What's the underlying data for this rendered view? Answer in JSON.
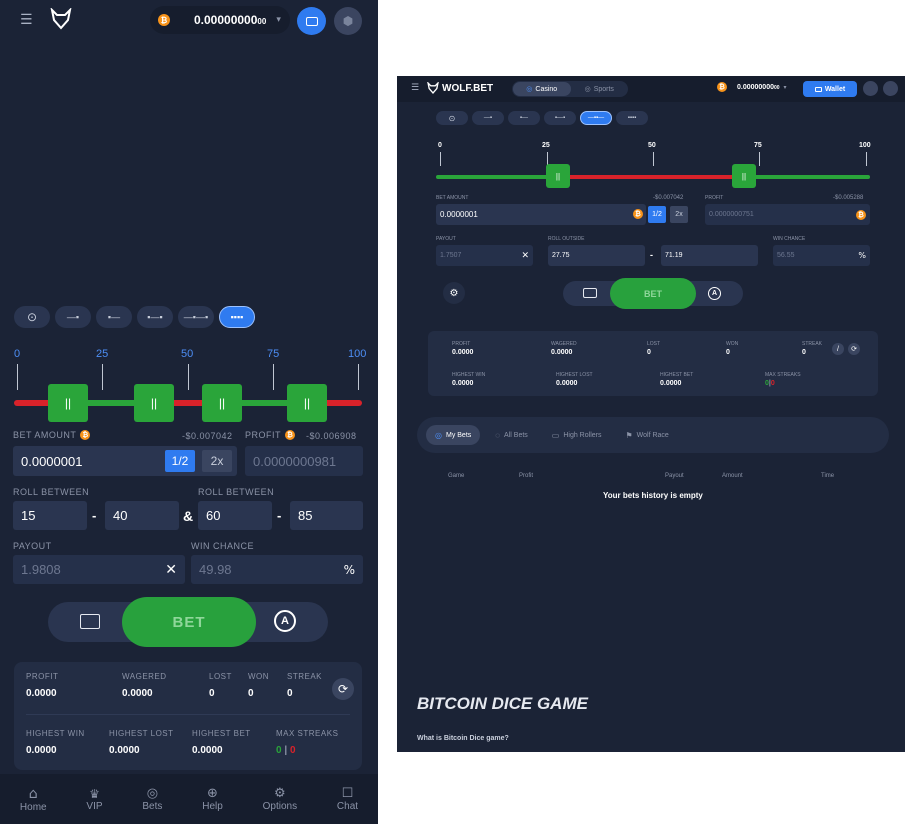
{
  "mobile": {
    "balance": "0.00000000",
    "balance_suffix": "00",
    "bet_types": [
      "⊙",
      "—▪",
      "▪—",
      "▪—▪",
      "—▪—▪",
      "▪▪▪▪"
    ],
    "slider_ticks": [
      "0",
      "25",
      "50",
      "75",
      "100"
    ],
    "bet_amount_label": "BET AMOUNT",
    "bet_amount_usd": "-$0.007042",
    "profit_label": "PROFIT",
    "profit_usd": "-$0.006908",
    "bet_amount_value": "0.0000001",
    "half": "1/2",
    "double": "2x",
    "profit_value": "0.0000000981",
    "roll_between_1": "ROLL BETWEEN",
    "roll_between_2": "ROLL BETWEEN",
    "range1_low": "15",
    "range1_high": "40",
    "range2_low": "60",
    "range2_high": "85",
    "dash": "-",
    "amp": "&",
    "payout_label": "PAYOUT",
    "payout_value": "1.9808",
    "win_chance_label": "WIN CHANCE",
    "win_chance_value": "49.98",
    "bet_button": "BET",
    "stats": {
      "profit_label": "PROFIT",
      "profit": "0.0000",
      "wagered_label": "WAGERED",
      "wagered": "0.0000",
      "lost_label": "LOST",
      "lost": "0",
      "won_label": "WON",
      "won": "0",
      "streak_label": "STREAK",
      "streak": "0",
      "highest_win_label": "HIGHEST WIN",
      "highest_win": "0.0000",
      "highest_lost_label": "HIGHEST LOST",
      "highest_lost": "0.0000",
      "highest_bet_label": "HIGHEST BET",
      "highest_bet": "0.0000",
      "max_streaks_label": "MAX STREAKS",
      "max_win_streak": "0",
      "max_sep": "|",
      "max_lose_streak": "0"
    },
    "nav": [
      "Home",
      "VIP",
      "Bets",
      "Help",
      "Options",
      "Chat"
    ]
  },
  "desktop": {
    "logo": "WOLF.BET",
    "tab_casino": "Casino",
    "tab_sports": "Sports",
    "balance": "0.00000000",
    "balance_suffix": "00",
    "wallet": "Wallet",
    "slider_ticks": [
      "0",
      "25",
      "50",
      "75",
      "100"
    ],
    "bet_amount_label": "BET AMOUNT",
    "bet_amount_usd": "-$0.007042",
    "bet_amount_value": "0.0000001",
    "half": "1/2",
    "double": "2x",
    "profit_label": "PROFIT",
    "profit_usd": "-$0.005288",
    "profit_value": "0.0000000751",
    "payout_label": "PAYOUT",
    "payout_value": "1.7507",
    "roll_outside_label": "ROLL OUTSIDE",
    "roll_low": "27.75",
    "roll_dash": "-",
    "roll_high": "71.19",
    "win_chance_label": "WIN CHANCE",
    "win_chance_value": "56.55",
    "bet_button": "BET",
    "stats": {
      "profit_label": "PROFIT",
      "profit": "0.0000",
      "wagered_label": "WAGERED",
      "wagered": "0.0000",
      "lost_label": "LOST",
      "lost": "0",
      "won_label": "WON",
      "won": "0",
      "streak_label": "STREAK",
      "streak": "0",
      "highest_win_label": "HIGHEST WIN",
      "highest_win": "0.0000",
      "highest_lost_label": "HIGHEST LOST",
      "highest_lost": "0.0000",
      "highest_bet_label": "HIGHEST BET",
      "highest_bet": "0.0000",
      "max_streaks_label": "MAX STREAKS",
      "max_win_streak": "0",
      "max_sep": "|",
      "max_lose_streak": "0"
    },
    "bet_tabs": [
      "My Bets",
      "All Bets",
      "High Rollers",
      "Wolf Race"
    ],
    "table_headers": [
      "Game",
      "Profit",
      "Payout",
      "Amount",
      "Time"
    ],
    "empty_text": "Your bets history is empty",
    "seo_title": "BITCOIN DICE GAME",
    "seo_sub": "What is Bitcoin Dice game?"
  },
  "colors": {
    "bg": "#1b2336",
    "accent": "#2f7bf0",
    "green": "#2aa53a",
    "red": "#d9222a",
    "coin": "#f7931a"
  },
  "icons": [
    "menu-icon",
    "wolf-logo-icon",
    "bitcoin-icon",
    "chevron-down-icon",
    "wallet-icon",
    "shield-icon",
    "settings-icon",
    "auto-icon",
    "refresh-icon",
    "close-icon",
    "percent-icon",
    "home-icon",
    "vip-icon",
    "bets-icon",
    "help-icon",
    "options-icon",
    "chat-icon"
  ]
}
